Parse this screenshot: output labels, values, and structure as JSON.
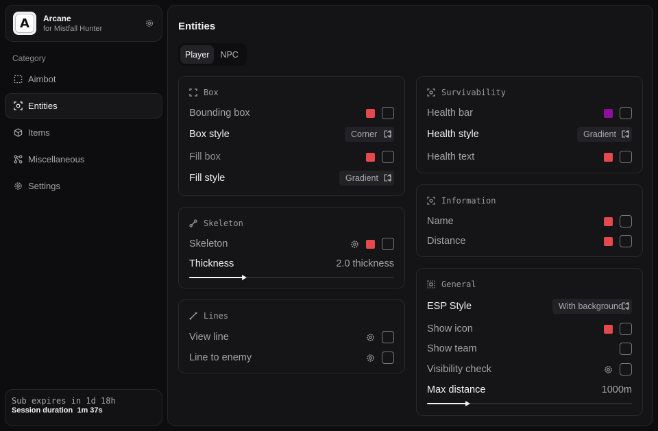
{
  "colors": {
    "accent_red": "#e5484d",
    "accent_purple": "#8e0f9e",
    "bg": "#0d0d0f"
  },
  "app": {
    "logo_letter": "A",
    "name": "Arcane",
    "subtitle": "for Mistfall Hunter"
  },
  "sidebar": {
    "category_label": "Category",
    "items": [
      {
        "label": "Aimbot",
        "icon": "crosshair-icon"
      },
      {
        "label": "Entities",
        "icon": "user-focus-icon",
        "active": true
      },
      {
        "label": "Items",
        "icon": "cube-icon"
      },
      {
        "label": "Miscellaneous",
        "icon": "nodes-icon"
      },
      {
        "label": "Settings",
        "icon": "gear-icon"
      }
    ],
    "subscription": {
      "expires": "Sub expires in 1d 18h",
      "session": "Session duration  1m 37s"
    }
  },
  "main": {
    "title": "Entities",
    "tabs": [
      {
        "label": "Player",
        "active": true
      },
      {
        "label": "NPC"
      }
    ],
    "box": {
      "title": "Box",
      "bounding_box": {
        "label": "Bounding box",
        "color": "#e5484d",
        "checked": false
      },
      "box_style": {
        "label": "Box style",
        "value": "Corner"
      },
      "fill_box": {
        "label": "Fill box",
        "color": "#e5484d",
        "checked": false
      },
      "fill_style": {
        "label": "Fill style",
        "value": "Gradient"
      }
    },
    "skeleton": {
      "title": "Skeleton",
      "skeleton": {
        "label": "Skeleton",
        "color": "#e5484d",
        "checked": false
      },
      "thickness": {
        "label": "Thickness",
        "value_text": "2.0 thickness",
        "fraction": 0.27
      }
    },
    "lines": {
      "title": "Lines",
      "view_line": {
        "label": "View line",
        "checked": false
      },
      "line_to_enemy": {
        "label": "Line to enemy",
        "checked": false
      }
    },
    "survivability": {
      "title": "Survivability",
      "health_bar": {
        "label": "Health bar",
        "color": "#8e0f9e",
        "checked": false
      },
      "health_style": {
        "label": "Health style",
        "value": "Gradient"
      },
      "health_text": {
        "label": "Health text",
        "color": "#e5484d",
        "checked": false
      }
    },
    "information": {
      "title": "Information",
      "name": {
        "label": "Name",
        "color": "#e5484d",
        "checked": false
      },
      "distance": {
        "label": "Distance",
        "color": "#e5484d",
        "checked": false
      }
    },
    "general": {
      "title": "General",
      "esp_style": {
        "label": "ESP Style",
        "value": "With background"
      },
      "show_icon": {
        "label": "Show icon",
        "color": "#e5484d",
        "checked": false
      },
      "show_team": {
        "label": "Show team",
        "checked": false
      },
      "visibility_check": {
        "label": "Visibility check",
        "checked": false
      },
      "max_distance": {
        "label": "Max distance",
        "value_text": "1000m",
        "fraction": 0.2
      }
    }
  }
}
